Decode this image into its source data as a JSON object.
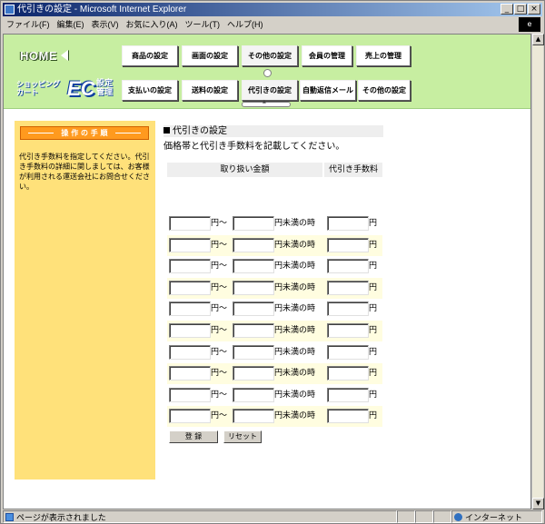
{
  "window": {
    "title": "代引きの設定 - Microsoft Internet Explorer",
    "controls": [
      "_",
      "□",
      "×"
    ]
  },
  "menu": [
    "ファイル(F)",
    "編集(E)",
    "表示(V)",
    "お気に入り(A)",
    "ツール(T)",
    "ヘルプ(H)"
  ],
  "header": {
    "home_label": "HOME",
    "logo_kana_line1": "ショッピング",
    "logo_kana_line2": "カート",
    "logo_ec": "EC",
    "logo_mgmt_line1": "設定",
    "logo_mgmt_line2": "管理",
    "nav_row1": [
      "商品の設定",
      "画面の設定",
      "その他の設定",
      "会員の管理",
      "売上の管理"
    ],
    "nav_row2": [
      "支払いの設定",
      "送料の設定",
      "代引きの設定",
      "自動返信メール",
      "その他の設定"
    ]
  },
  "sidebar": {
    "heading": "操 作 の 手 順",
    "text": "代引き手数料を指定してください。代引き手数料の詳細に関しましては、お客様が利用される運送会社にお問合せください。"
  },
  "main": {
    "title": "代引きの設定",
    "description": "価格帯と代引き手数料を記載してください。",
    "col_range": "取り扱い金額",
    "col_fee": "代引き手数料",
    "label_from": "円～",
    "label_under": "円未満の時",
    "label_yen": "円",
    "rows": [
      {
        "min": "",
        "max": "",
        "fee": ""
      },
      {
        "min": "",
        "max": "",
        "fee": ""
      },
      {
        "min": "",
        "max": "",
        "fee": ""
      },
      {
        "min": "",
        "max": "",
        "fee": ""
      },
      {
        "min": "",
        "max": "",
        "fee": ""
      },
      {
        "min": "",
        "max": "",
        "fee": ""
      },
      {
        "min": "",
        "max": "",
        "fee": ""
      },
      {
        "min": "",
        "max": "",
        "fee": ""
      },
      {
        "min": "",
        "max": "",
        "fee": ""
      },
      {
        "min": "",
        "max": "",
        "fee": ""
      }
    ],
    "submit_label": "登 録",
    "reset_label": "リセット"
  },
  "status": {
    "text": "ページが表示されました",
    "zone": "インターネット"
  }
}
